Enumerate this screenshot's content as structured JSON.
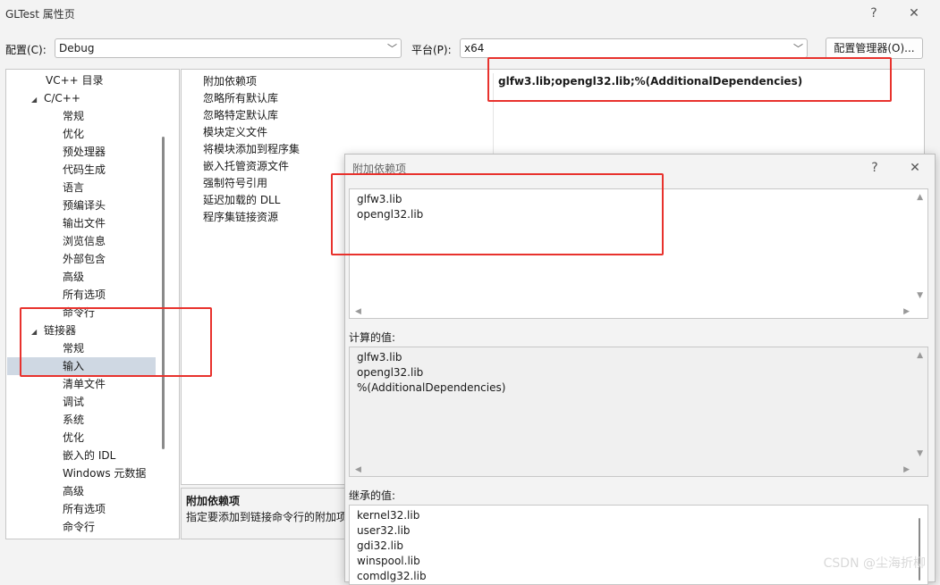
{
  "window": {
    "title": "GLTest 属性页",
    "help_label": "?",
    "close_label": "✕"
  },
  "toolbar": {
    "config_label": "配置(C):",
    "config_value": "Debug",
    "platform_label": "平台(P):",
    "platform_value": "x64",
    "config_manager_button": "配置管理器(O)..."
  },
  "tree": {
    "items": [
      {
        "label": "VC++ 目录"
      },
      {
        "label": "C/C++"
      },
      {
        "label": "常规"
      },
      {
        "label": "优化"
      },
      {
        "label": "预处理器"
      },
      {
        "label": "代码生成"
      },
      {
        "label": "语言"
      },
      {
        "label": "预编译头"
      },
      {
        "label": "输出文件"
      },
      {
        "label": "浏览信息"
      },
      {
        "label": "外部包含"
      },
      {
        "label": "高级"
      },
      {
        "label": "所有选项"
      },
      {
        "label": "命令行"
      },
      {
        "label": "链接器"
      },
      {
        "label": "常规"
      },
      {
        "label": "输入"
      },
      {
        "label": "清单文件"
      },
      {
        "label": "调试"
      },
      {
        "label": "系统"
      },
      {
        "label": "优化"
      },
      {
        "label": "嵌入的 IDL"
      },
      {
        "label": "Windows 元数据"
      },
      {
        "label": "高级"
      },
      {
        "label": "所有选项"
      },
      {
        "label": "命令行"
      }
    ]
  },
  "properties": {
    "rows": [
      {
        "name": "附加依赖项",
        "value": "glfw3.lib;opengl32.lib;%(AdditionalDependencies)"
      },
      {
        "name": "忽略所有默认库",
        "value": ""
      },
      {
        "name": "忽略特定默认库",
        "value": ""
      },
      {
        "name": "模块定义文件",
        "value": ""
      },
      {
        "name": "将模块添加到程序集",
        "value": ""
      },
      {
        "name": "嵌入托管资源文件",
        "value": ""
      },
      {
        "name": "强制符号引用",
        "value": ""
      },
      {
        "name": "延迟加载的 DLL",
        "value": ""
      },
      {
        "name": "程序集链接资源",
        "value": ""
      }
    ]
  },
  "description": {
    "title": "附加依赖项",
    "text": "指定要添加到链接命令行的附加项"
  },
  "dialog": {
    "title": "附加依赖项",
    "help_label": "?",
    "close_label": "✕",
    "edit_lines": [
      "glfw3.lib",
      "opengl32.lib"
    ],
    "computed_label": "计算的值:",
    "computed_lines": [
      "glfw3.lib",
      "opengl32.lib",
      "%(AdditionalDependencies)"
    ],
    "inherited_label": "继承的值:",
    "inherited_lines": [
      "kernel32.lib",
      "user32.lib",
      "gdi32.lib",
      "winspool.lib",
      "comdlg32.lib"
    ]
  },
  "watermark": "CSDN @尘海折柳"
}
